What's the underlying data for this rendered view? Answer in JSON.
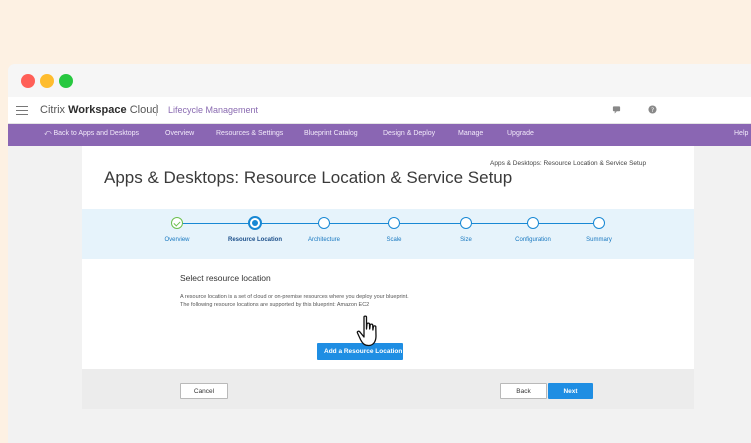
{
  "app": {
    "brand_light": "Citrix",
    "brand_bold": "Workspace",
    "brand_tail": "Cloud",
    "product": "Lifecycle Management"
  },
  "nav": {
    "back": "Back to Apps and Desktops",
    "items": [
      "Overview",
      "Resources & Settings",
      "Blueprint Catalog",
      "Design & Deploy",
      "Manage",
      "Upgrade"
    ],
    "help": "Help"
  },
  "page": {
    "title": "Apps & Desktops: Resource Location & Service Setup",
    "right_title": "Apps & Desktops: Resource Location & Service Setup"
  },
  "steps": [
    {
      "label": "Overview",
      "state": "done"
    },
    {
      "label": "Resource Location",
      "state": "active"
    },
    {
      "label": "Architecture",
      "state": "pending"
    },
    {
      "label": "Scale",
      "state": "pending"
    },
    {
      "label": "Size",
      "state": "pending"
    },
    {
      "label": "Configuration",
      "state": "pending"
    },
    {
      "label": "Summary",
      "state": "pending"
    }
  ],
  "section": {
    "title": "Select resource location",
    "desc_line1": "A resource location is a set of cloud or on-premise resources where you deploy your blueprint.",
    "desc_line2": "The following resource locations are supported by this blueprint: Amazon EC2",
    "add_button": "Add a Resource Location"
  },
  "footer": {
    "cancel": "Cancel",
    "back": "Back",
    "next": "Next"
  },
  "colors": {
    "accent": "#1f8ee3",
    "nav_bg": "#8a66b3",
    "done": "#6bbf4e"
  }
}
